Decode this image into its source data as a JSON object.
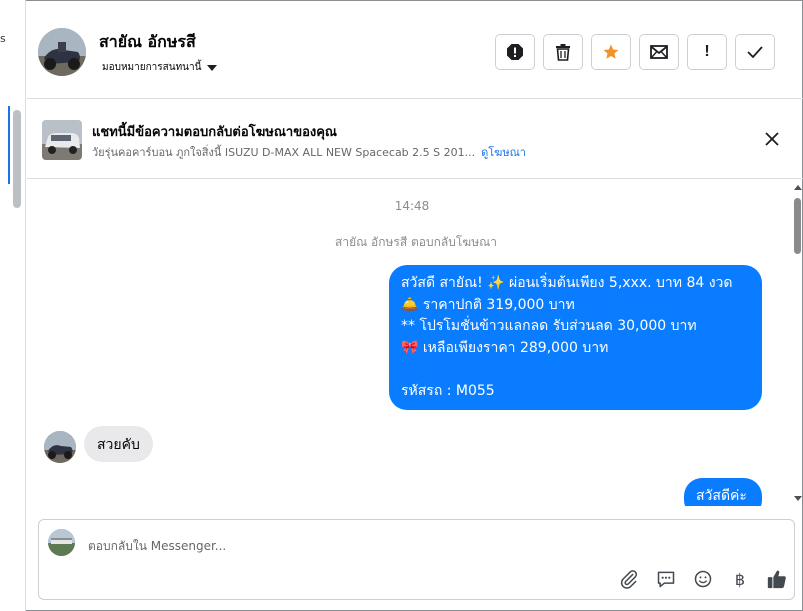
{
  "left_panel": {
    "stray_char": "s"
  },
  "header": {
    "contact_name": "สายัณ อักษรสี",
    "assign_label": "มอบหมายการสนทนานี้",
    "actions": [
      {
        "icon": "report-icon"
      },
      {
        "icon": "trash-icon"
      },
      {
        "icon": "star-icon"
      },
      {
        "icon": "mail-icon"
      },
      {
        "icon": "exclamation-icon",
        "glyph": "!"
      },
      {
        "icon": "check-icon"
      }
    ],
    "star_color": "#f0932b"
  },
  "ad_banner": {
    "title": "แชทนี้มีข้อความตอบกลับต่อโฆษณาของคุณ",
    "ad_text": "วัยรุ่นคอคาร์บอน ภูกใจสิ่งนี้ ISUZU D-MAX ALL NEW Spacecab 2.5 S 201...",
    "link_label": "ดูโฆษณา"
  },
  "chat": {
    "timestamp": "14:48",
    "reply_note": "สายัณ อักษรสี ตอบกลับโฆษณา",
    "outgoing_main_lines": [
      "สวัสดี สายัณ! ✨  ผ่อนเริ่มต้นเพียง 5,xxx. บาท 84 งวด",
      "🛎️ ราคาปกติ 319,000 บาท",
      "** โปรโมชั่นข้าวแลกลด รับส่วนลด 30,000 บาท",
      "🎀  เหลือเพียงราคา 289,000 บาท",
      "",
      "รหัสรถ : M055"
    ],
    "incoming_message": "สวยคับ",
    "outgoing_short": "สวัสดีค่ะ",
    "bubble_color": "#0a7cff"
  },
  "composer": {
    "placeholder": "ตอบกลับใน Messenger...",
    "tools": [
      "paperclip-icon",
      "quick-reply-icon",
      "emoji-icon",
      "baht-icon",
      "thumbs-up-icon"
    ],
    "baht_glyph": "฿"
  }
}
